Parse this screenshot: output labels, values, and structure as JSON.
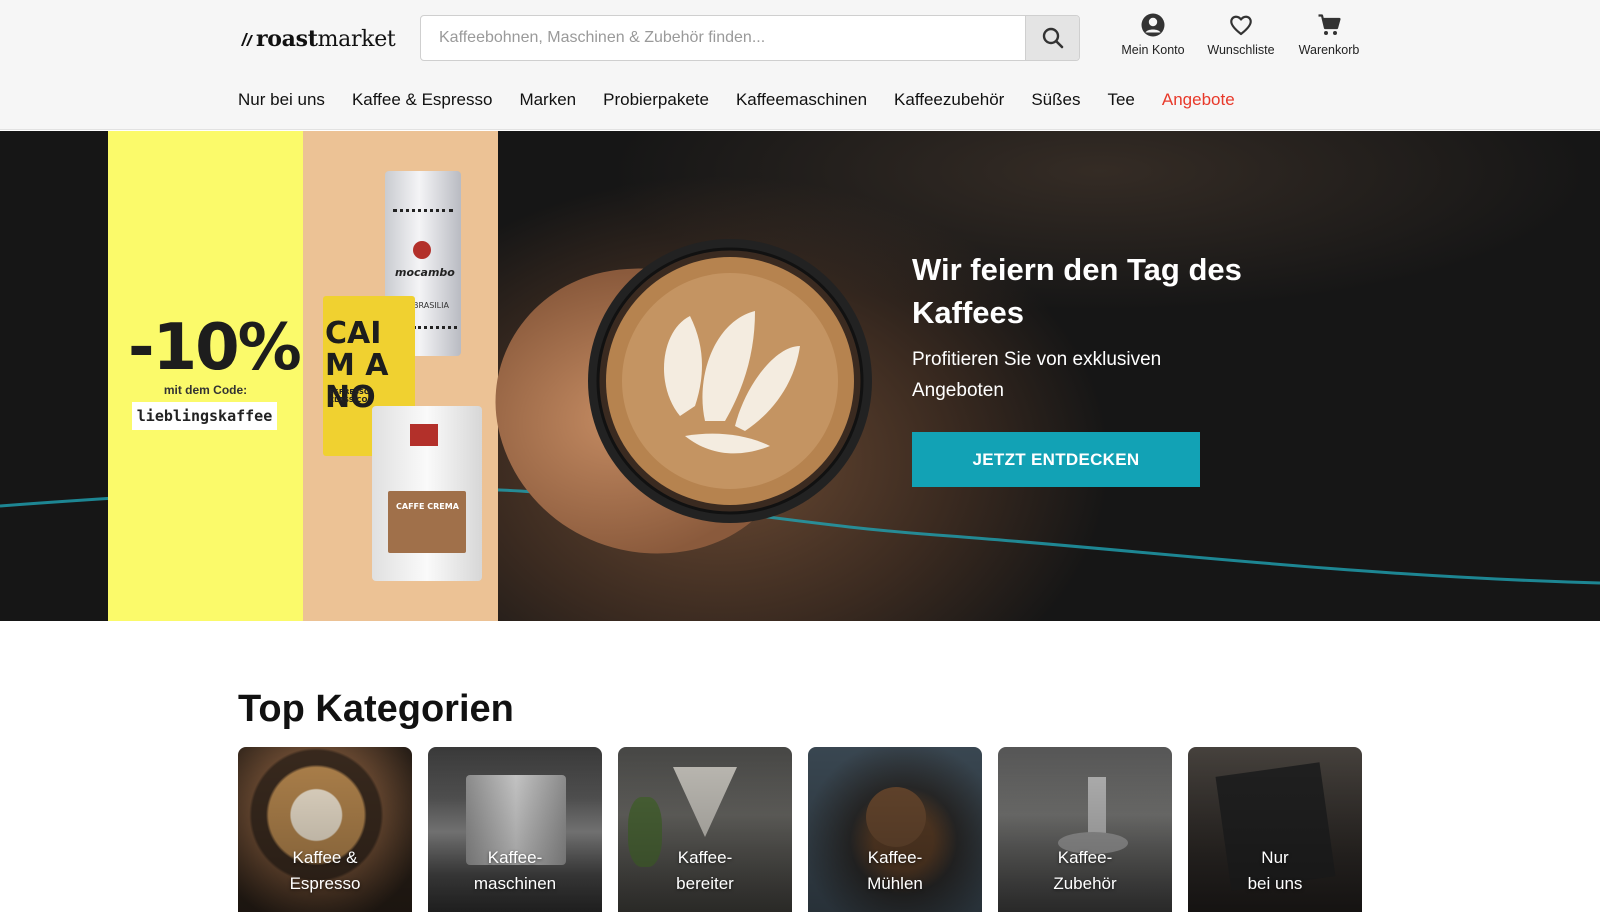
{
  "header": {
    "logo_bold": "roast",
    "logo_light": "market",
    "search_placeholder": "Kaffeebohnen, Maschinen & Zubehör finden...",
    "account_label": "Mein Konto",
    "wishlist_label": "Wunschliste",
    "cart_label": "Warenkorb"
  },
  "nav": {
    "items": [
      "Nur bei uns",
      "Kaffee & Espresso",
      "Marken",
      "Probierpakete",
      "Kaffeemaschinen",
      "Kaffeezubehör",
      "Süßes",
      "Tee",
      "Angebote"
    ]
  },
  "hero": {
    "discount": "-10%",
    "code_label": "mit dem Code:",
    "code": "lieblingskaffee",
    "bag1_brand": "mocambo",
    "bag1_name": "BRASILIA",
    "bag2_name": "CAIM ANO",
    "bag2_sub": "ESPRESSO CLASSICO",
    "bag3_name": "CAFFE CREMA",
    "title": "Wir feiern den Tag des Kaffees",
    "subtitle": "Profitieren Sie von exklusiven Angeboten",
    "cta": "JETZT ENTDECKEN"
  },
  "categories": {
    "title": "Top Kategorien",
    "items": [
      {
        "label": "Kaffee &\nEspresso"
      },
      {
        "label": "Kaffee-\nmaschinen"
      },
      {
        "label": "Kaffee-\nbereiter"
      },
      {
        "label": "Kaffee-\nMühlen"
      },
      {
        "label": "Kaffee-\nZubehör"
      },
      {
        "label": "Nur\nbei uns"
      }
    ]
  },
  "colors": {
    "accent_teal": "#12a2b5",
    "offers_red": "#e8392a",
    "promo_yellow": "#fbfa6a",
    "promo_beige": "#ecc295"
  }
}
